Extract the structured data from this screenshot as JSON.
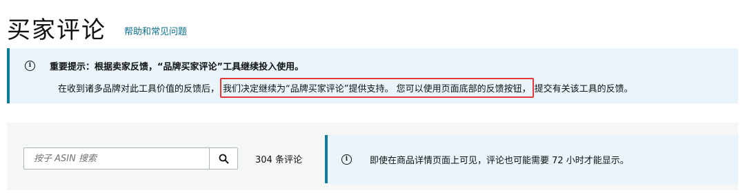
{
  "header": {
    "title": "买家评论",
    "help_link": "帮助和常见问题"
  },
  "notice": {
    "icon": "info-icon",
    "title": "重要提示：根据卖家反馈，“品牌买家评论”工具继续投入使用。",
    "body_before": "在收到诸多品牌对此工具价值的反馈后，",
    "body_highlight": "我们决定继续为“品牌买家评论”提供支持。 您可以使用页面底部的反馈按钮，",
    "body_after": "提交有关该工具的反馈。",
    "highlight_color": "#e0373b",
    "accent_color": "#0f7a9c"
  },
  "search": {
    "placeholder": "按子 ASIN 搜索",
    "button_icon": "search-icon",
    "review_count": "304 条评论"
  },
  "info": {
    "icon": "info-icon",
    "text": "即使在商品详情页面上可见，评论也可能需要 72 小时才能显示。"
  }
}
